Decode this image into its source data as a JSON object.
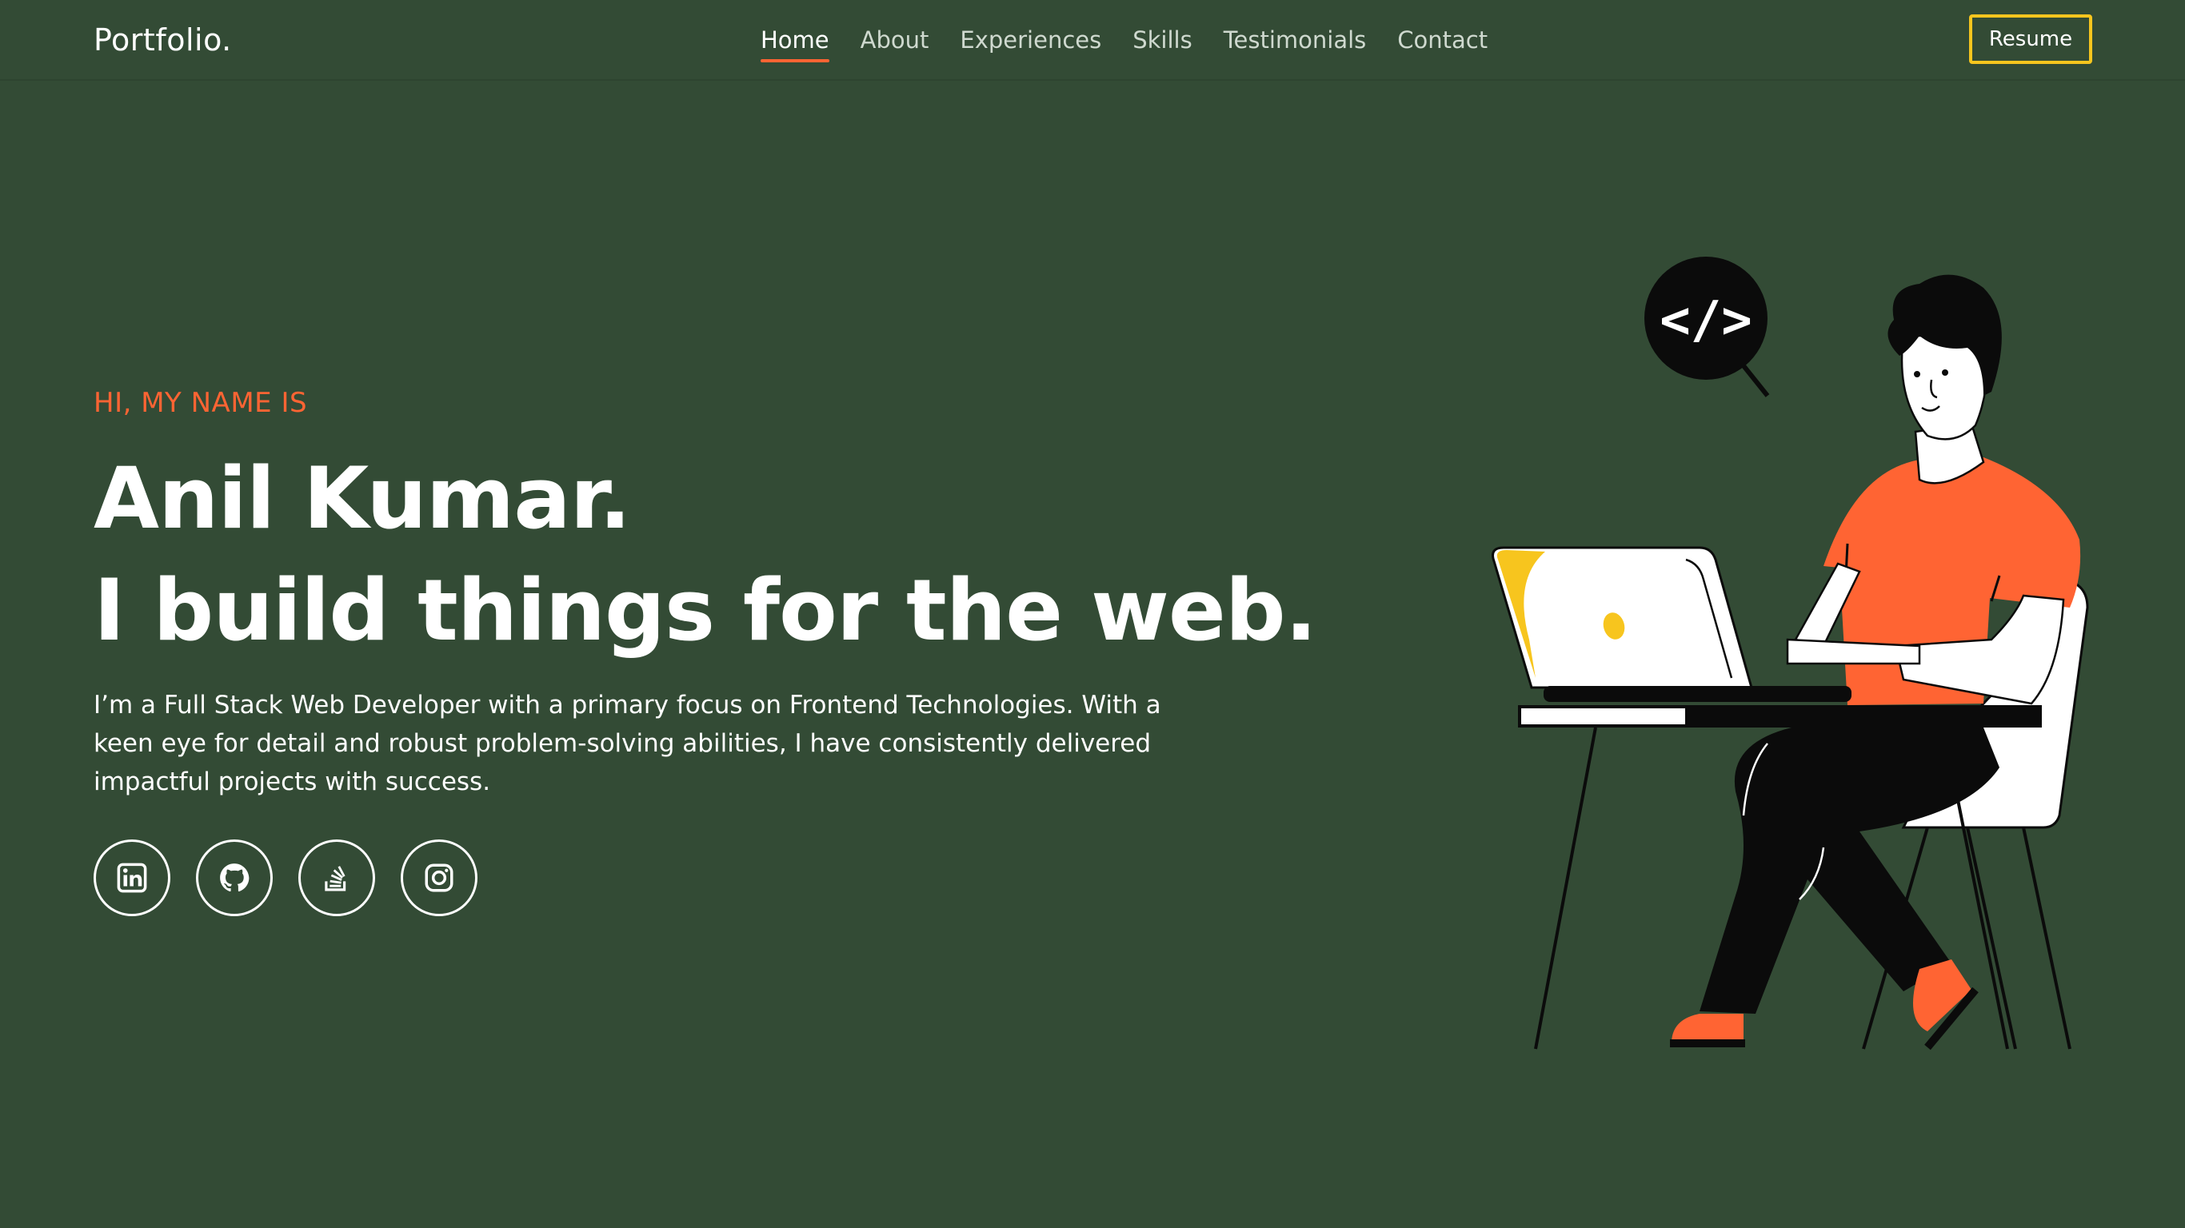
{
  "brand": "Portfolio.",
  "nav": {
    "links": [
      "Home",
      "About",
      "Experiences",
      "Skills",
      "Testimonials",
      "Contact"
    ],
    "active": "Home",
    "resume_label": "Resume"
  },
  "hero": {
    "greeting": "HI, MY NAME IS",
    "name_line": "Anil Kumar.",
    "tagline": "I build things for the web.",
    "intro": "I’m a Full Stack Web Developer with a primary focus on Frontend Technologies. With a keen eye for detail and robust problem-solving abilities, I have consistently delivered impactful projects with success."
  },
  "socials": [
    {
      "name": "linkedin",
      "icon": "linkedin-icon"
    },
    {
      "name": "github",
      "icon": "github-icon"
    },
    {
      "name": "stackoverflow",
      "icon": "stackoverflow-icon"
    },
    {
      "name": "instagram",
      "icon": "instagram-icon"
    }
  ],
  "illustration": {
    "bubble_text": "</>"
  },
  "colors": {
    "background": "#334b35",
    "accent": "#ff6433",
    "highlight": "#f7c51e",
    "text": "#ffffff"
  }
}
